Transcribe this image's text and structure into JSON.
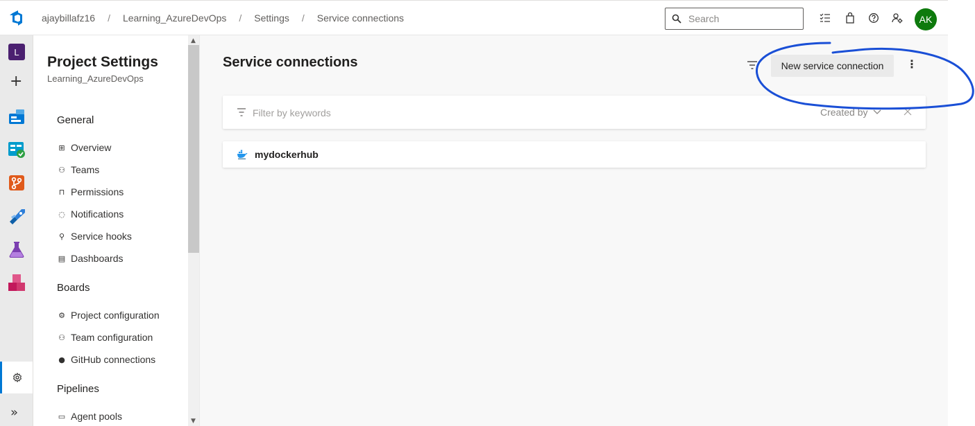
{
  "header": {
    "breadcrumbs": [
      "ajaybillafz16",
      "Learning_AzureDevOps",
      "Settings",
      "Service connections"
    ],
    "search_placeholder": "Search",
    "avatar_initials": "AK",
    "avatar_color": "#0e7a0d"
  },
  "rail": {
    "org_initial": "L",
    "org_color": "#4b2070",
    "icons": [
      "add-icon",
      "overview-icon",
      "boards-icon",
      "repos-icon",
      "pipelines-icon",
      "test-plans-icon",
      "artifacts-icon",
      "settings-icon",
      "expand-icon"
    ]
  },
  "nav": {
    "title": "Project Settings",
    "subtitle": "Learning_AzureDevOps",
    "sections": [
      {
        "label": "General",
        "items": [
          "Overview",
          "Teams",
          "Permissions",
          "Notifications",
          "Service hooks",
          "Dashboards"
        ]
      },
      {
        "label": "Boards",
        "items": [
          "Project configuration",
          "Team configuration",
          "GitHub connections"
        ]
      },
      {
        "label": "Pipelines",
        "items": [
          "Agent pools"
        ]
      }
    ]
  },
  "main": {
    "title": "Service connections",
    "new_button_label": "New service connection",
    "filter_placeholder": "Filter by keywords",
    "created_by_label": "Created by",
    "connections": [
      {
        "name": "mydockerhub",
        "icon": "docker-icon"
      }
    ]
  },
  "colors": {
    "accent": "#0078d4",
    "annotation_circle": "#1a4fd6"
  }
}
